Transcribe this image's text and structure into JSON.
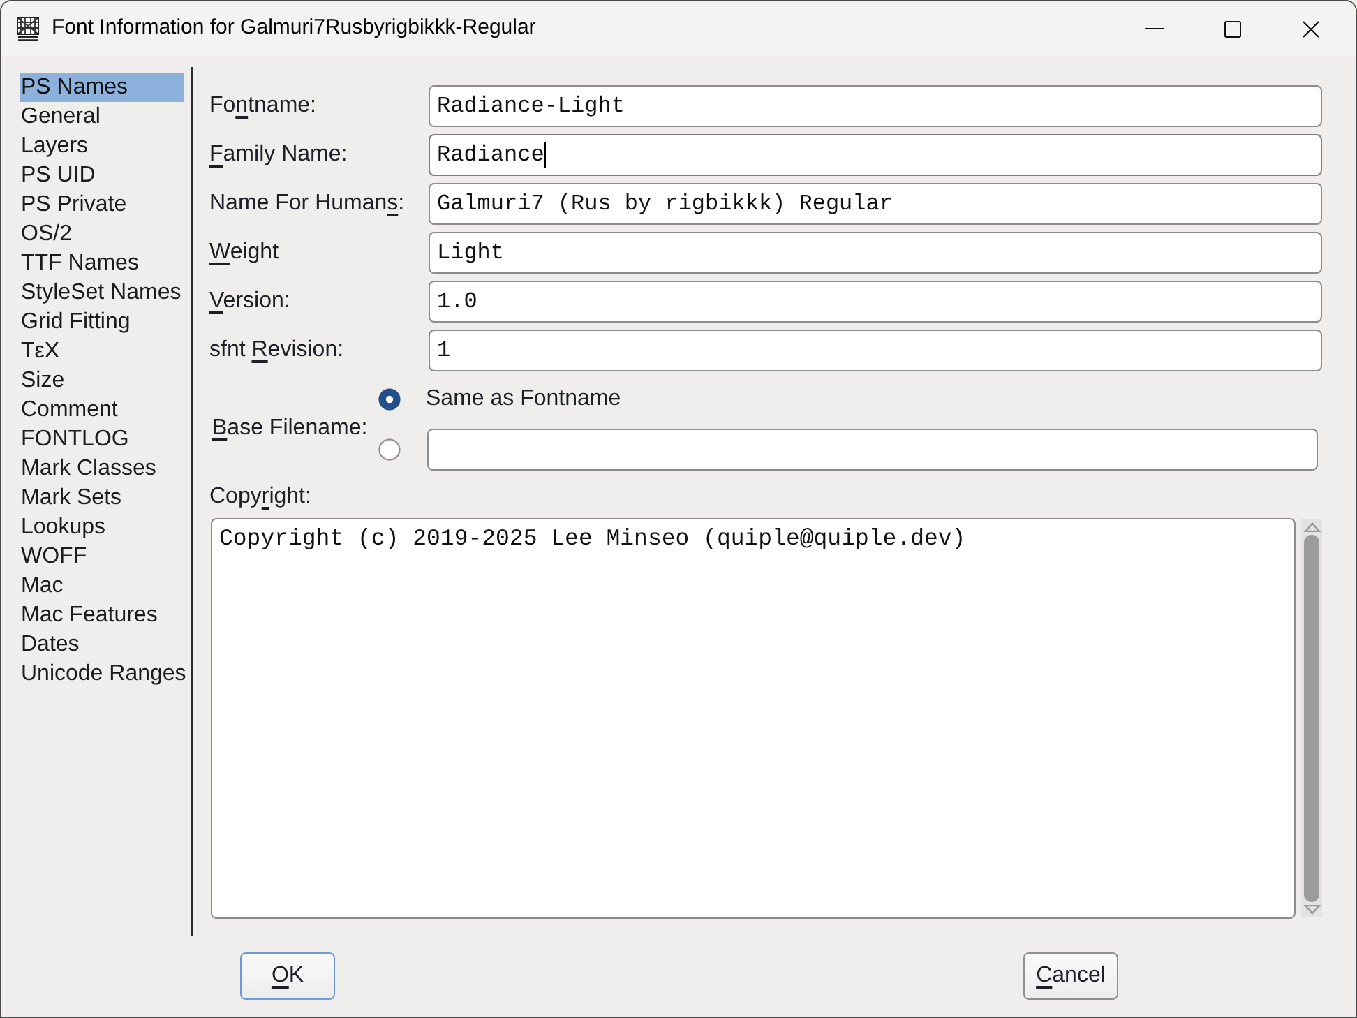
{
  "window": {
    "title": "Font Information for Galmuri7Rusbyrigbikkk-Regular"
  },
  "sidebar": {
    "items": [
      {
        "label": "PS Names",
        "selected": true
      },
      {
        "label": "General",
        "selected": false
      },
      {
        "label": "Layers",
        "selected": false
      },
      {
        "label": "PS UID",
        "selected": false
      },
      {
        "label": "PS Private",
        "selected": false
      },
      {
        "label": "OS/2",
        "selected": false
      },
      {
        "label": "TTF Names",
        "selected": false
      },
      {
        "label": "StyleSet Names",
        "selected": false
      },
      {
        "label": "Grid Fitting",
        "selected": false
      },
      {
        "label": "TεX",
        "selected": false
      },
      {
        "label": "Size",
        "selected": false
      },
      {
        "label": "Comment",
        "selected": false
      },
      {
        "label": "FONTLOG",
        "selected": false
      },
      {
        "label": "Mark Classes",
        "selected": false
      },
      {
        "label": "Mark Sets",
        "selected": false
      },
      {
        "label": "Lookups",
        "selected": false
      },
      {
        "label": "WOFF",
        "selected": false
      },
      {
        "label": "Mac",
        "selected": false
      },
      {
        "label": "Mac Features",
        "selected": false
      },
      {
        "label": "Dates",
        "selected": false
      },
      {
        "label": "Unicode Ranges",
        "selected": false
      }
    ]
  },
  "fields": [
    {
      "label": {
        "before": "Fo",
        "key": "n",
        "after": "tname:"
      },
      "value": "Radiance-Light",
      "focused": false
    },
    {
      "label": {
        "key": "F",
        "after": "amily Name:"
      },
      "value": "Radiance",
      "focused": true
    },
    {
      "label": {
        "before": "Name For Human",
        "key": "s",
        "after": ":"
      },
      "value": "Galmuri7 (Rus by rigbikkk) Regular",
      "focused": false
    },
    {
      "label": {
        "key": "W",
        "after": "eight"
      },
      "value": "Light",
      "focused": false
    },
    {
      "label": {
        "key": "V",
        "after": "ersion:"
      },
      "value": "1.0",
      "focused": false
    },
    {
      "label": {
        "before": "sfnt ",
        "key": "R",
        "after": "evision:"
      },
      "value": "1",
      "focused": false
    }
  ],
  "base_filename": {
    "label": {
      "key": "B",
      "after": "ase Filename:"
    },
    "options": [
      {
        "kind": "label",
        "text": "Same as Fontname",
        "selected": true
      },
      {
        "kind": "field",
        "selected": false
      }
    ]
  },
  "copyright": {
    "label": {
      "before": "Copy",
      "key": "r",
      "after": "ight:"
    },
    "value": "Copyright (c) 2019-2025 Lee Minseo (quiple@quiple.dev)"
  },
  "buttons": [
    {
      "kind": "default",
      "label": {
        "key": "O",
        "after": "K"
      }
    },
    {
      "kind": "normal",
      "label": {
        "key": "C",
        "after": "ancel"
      }
    }
  ]
}
